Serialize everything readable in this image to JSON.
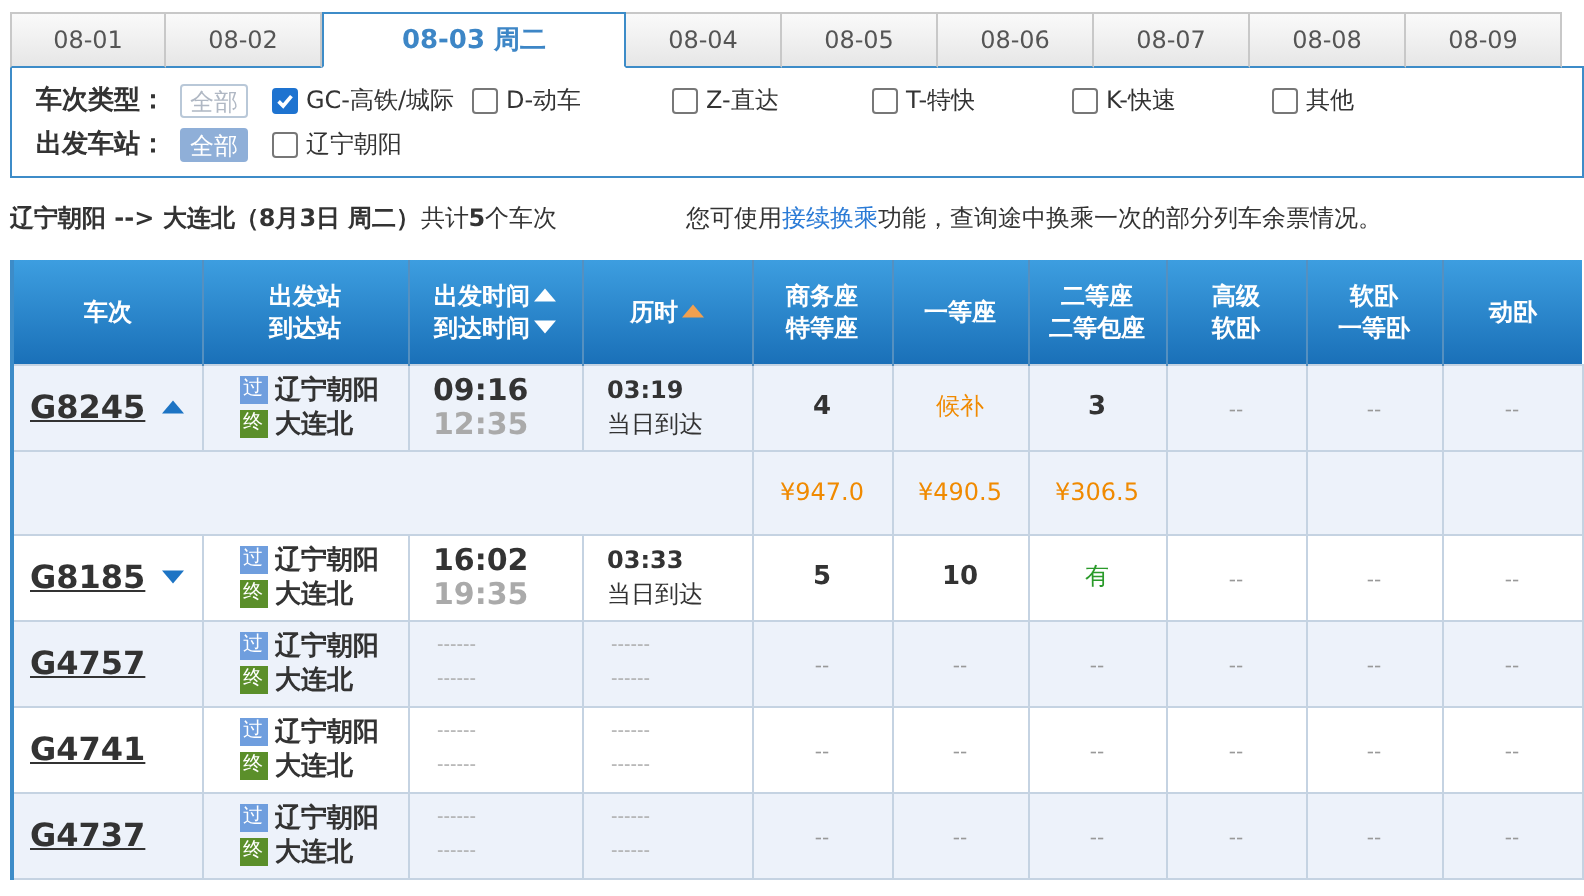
{
  "date_tabs": [
    {
      "label": "08-01",
      "selected": false
    },
    {
      "label": "08-02",
      "selected": false
    },
    {
      "label": "08-03 周二",
      "selected": true
    },
    {
      "label": "08-04",
      "selected": false
    },
    {
      "label": "08-05",
      "selected": false
    },
    {
      "label": "08-06",
      "selected": false
    },
    {
      "label": "08-07",
      "selected": false
    },
    {
      "label": "08-08",
      "selected": false
    },
    {
      "label": "08-09",
      "selected": false
    }
  ],
  "filters": [
    {
      "label": "车次类型：",
      "all_button": {
        "label": "全部",
        "selected": false
      },
      "options": [
        {
          "label": "GC-高铁/城际",
          "checked": true
        },
        {
          "label": "D-动车",
          "checked": false
        },
        {
          "label": "Z-直达",
          "checked": false
        },
        {
          "label": "T-特快",
          "checked": false
        },
        {
          "label": "K-快速",
          "checked": false
        },
        {
          "label": "其他",
          "checked": false
        }
      ]
    },
    {
      "label": "出发车站：",
      "all_button": {
        "label": "全部",
        "selected": true
      },
      "options": [
        {
          "label": "辽宁朝阳",
          "checked": false
        }
      ]
    }
  ],
  "summary": "**辽宁朝阳 --> 大连北（8月3日  周二）**共计**5**个车次",
  "hint": {
    "before": "您可使用",
    "link": "接续换乘",
    "after": "功能，查询途中换乘一次的部分列车余票情况。"
  },
  "table": {
    "columns": [
      {
        "lines": [
          {
            "text": "车次",
            "kind": "plain"
          }
        ]
      },
      {
        "lines": [
          {
            "text": "出发站",
            "kind": "plain"
          },
          {
            "text": "到达站",
            "kind": "plain"
          }
        ]
      },
      {
        "lines": [
          {
            "text": "出发时间",
            "kind": "sort-up"
          },
          {
            "text": "到达时间",
            "kind": "sort-down"
          }
        ]
      },
      {
        "lines": [
          {
            "text": "历时",
            "kind": "sort-up-active"
          }
        ]
      },
      {
        "lines": [
          {
            "text": "商务座",
            "kind": "plain"
          },
          {
            "text": "特等座",
            "kind": "plain"
          }
        ]
      },
      {
        "lines": [
          {
            "text": "一等座",
            "kind": "plain"
          }
        ]
      },
      {
        "lines": [
          {
            "text": "二等座",
            "kind": "plain"
          },
          {
            "text": "二等包座",
            "kind": "plain"
          }
        ]
      },
      {
        "lines": [
          {
            "text": "高级",
            "kind": "plain"
          },
          {
            "text": "软卧",
            "kind": "plain"
          }
        ]
      },
      {
        "lines": [
          {
            "text": "软卧",
            "kind": "plain"
          },
          {
            "text": "一等卧",
            "kind": "plain"
          }
        ]
      },
      {
        "lines": [
          {
            "text": "动卧",
            "kind": "plain"
          }
        ]
      }
    ],
    "rows": [
      {
        "train": "G8245",
        "expanded": true,
        "kind": "timed",
        "from_badge": "过",
        "from": "辽宁朝阳",
        "to_badge": "终",
        "to": "大连北",
        "depart": "09:16",
        "arrive": "12:35",
        "duration": "03:19",
        "arrival_day": "当日到达",
        "seats": [
          {
            "text": "4",
            "kind": "count"
          },
          {
            "text": "候补",
            "kind": "waitlist"
          },
          {
            "text": "3",
            "kind": "count"
          },
          {
            "text": "--",
            "kind": "none"
          },
          {
            "text": "--",
            "kind": "none"
          },
          {
            "text": "--",
            "kind": "none"
          }
        ],
        "prices": [
          "¥947.0",
          "¥490.5",
          "¥306.5"
        ]
      },
      {
        "train": "G8185",
        "expanded": false,
        "kind": "timed",
        "from_badge": "过",
        "from": "辽宁朝阳",
        "to_badge": "终",
        "to": "大连北",
        "depart": "16:02",
        "arrive": "19:35",
        "duration": "03:33",
        "arrival_day": "当日到达",
        "seats": [
          {
            "text": "5",
            "kind": "count"
          },
          {
            "text": "10",
            "kind": "count"
          },
          {
            "text": "有",
            "kind": "available"
          },
          {
            "text": "--",
            "kind": "none"
          },
          {
            "text": "--",
            "kind": "none"
          },
          {
            "text": "--",
            "kind": "none"
          }
        ]
      },
      {
        "train": "G4757",
        "expanded": false,
        "kind": "unknown",
        "from_badge": "过",
        "from": "辽宁朝阳",
        "to_badge": "终",
        "to": "大连北",
        "depart": "------",
        "arrive": "------",
        "duration": "------",
        "arrival_day": "------",
        "seats": [
          {
            "text": "--",
            "kind": "none"
          },
          {
            "text": "--",
            "kind": "none"
          },
          {
            "text": "--",
            "kind": "none"
          },
          {
            "text": "--",
            "kind": "none"
          },
          {
            "text": "--",
            "kind": "none"
          },
          {
            "text": "--",
            "kind": "none"
          }
        ]
      },
      {
        "train": "G4741",
        "expanded": false,
        "kind": "unknown",
        "from_badge": "过",
        "from": "辽宁朝阳",
        "to_badge": "终",
        "to": "大连北",
        "depart": "------",
        "arrive": "------",
        "duration": "------",
        "arrival_day": "------",
        "seats": [
          {
            "text": "--",
            "kind": "none"
          },
          {
            "text": "--",
            "kind": "none"
          },
          {
            "text": "--",
            "kind": "none"
          },
          {
            "text": "--",
            "kind": "none"
          },
          {
            "text": "--",
            "kind": "none"
          },
          {
            "text": "--",
            "kind": "none"
          }
        ]
      },
      {
        "train": "G4737",
        "expanded": false,
        "kind": "unknown",
        "from_badge": "过",
        "from": "辽宁朝阳",
        "to_badge": "终",
        "to": "大连北",
        "depart": "------",
        "arrive": "------",
        "duration": "------",
        "arrival_day": "------",
        "seats": [
          {
            "text": "--",
            "kind": "none"
          },
          {
            "text": "--",
            "kind": "none"
          },
          {
            "text": "--",
            "kind": "none"
          },
          {
            "text": "--",
            "kind": "none"
          },
          {
            "text": "--",
            "kind": "none"
          },
          {
            "text": "--",
            "kind": "none"
          }
        ]
      }
    ]
  }
}
